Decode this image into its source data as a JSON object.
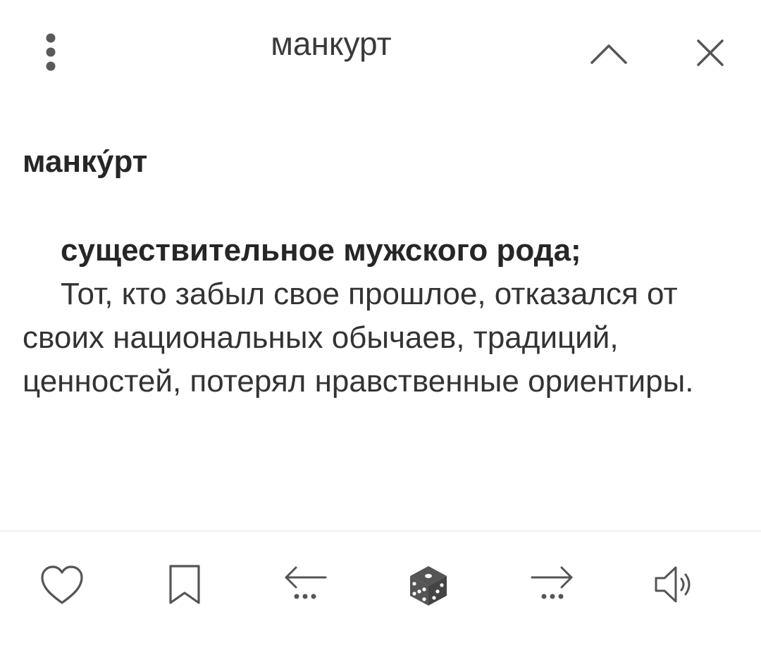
{
  "header": {
    "search_query": "манкурт"
  },
  "entry": {
    "headword": "манку́рт",
    "part_of_speech": "существительное мужского рода;",
    "definition": "Тот, кто забыл свое прошлое, отказался от своих национальных обычаев, традиций, ценностей, потерял нравственные ориентиры."
  },
  "icons": {
    "menu": "vertical-dots-icon",
    "up": "chevron-up-icon",
    "close": "close-icon",
    "favorite": "heart-icon",
    "bookmark": "bookmark-icon",
    "previous": "arrow-left-icon",
    "random": "dice-icon",
    "next": "arrow-right-icon",
    "audio": "speaker-icon"
  },
  "colors": {
    "icon": "#555555",
    "text": "#2b2b2b",
    "background": "#ffffff"
  }
}
